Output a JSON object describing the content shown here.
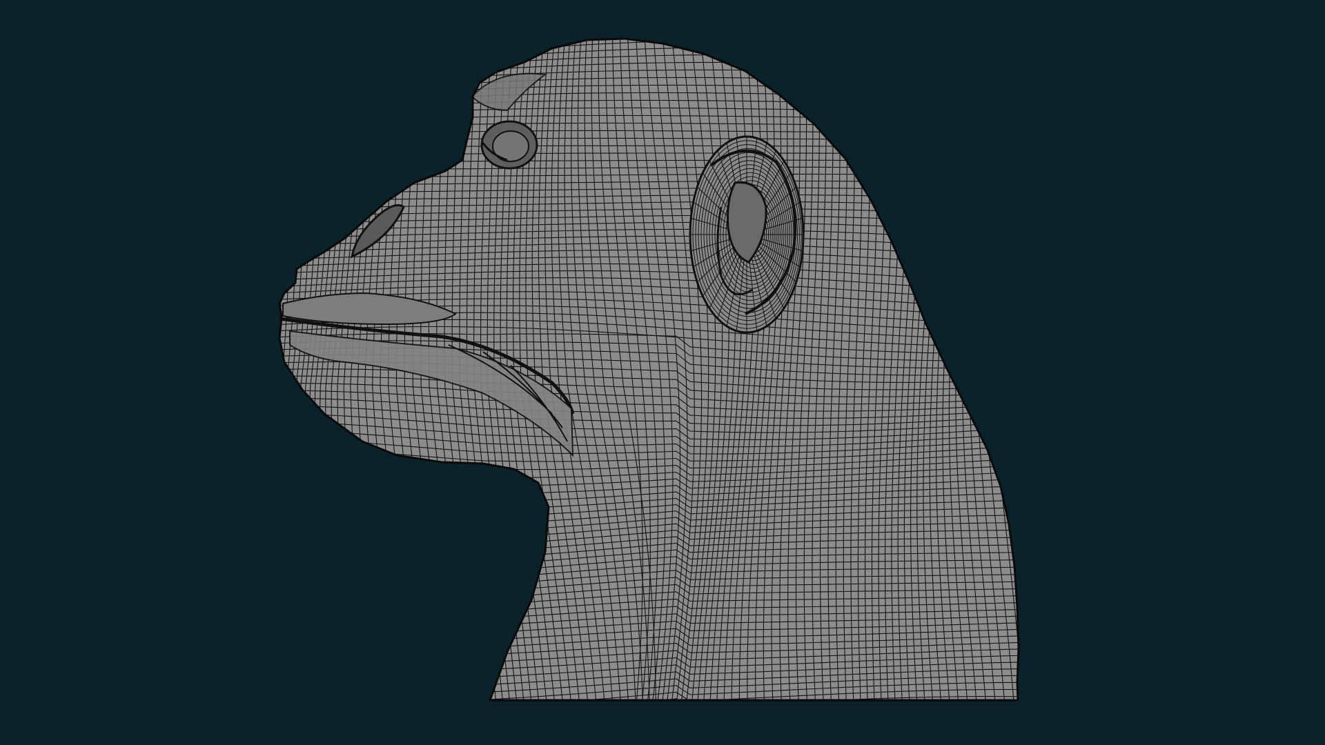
{
  "scene": {
    "background_color": "#0c222a",
    "mesh_fill_color": "#8d8d8d",
    "wireframe_color": "#111111",
    "shading": "wireframe-on-shaded",
    "subject": "chimpanzee-head-mesh",
    "view": "side-profile-left"
  }
}
